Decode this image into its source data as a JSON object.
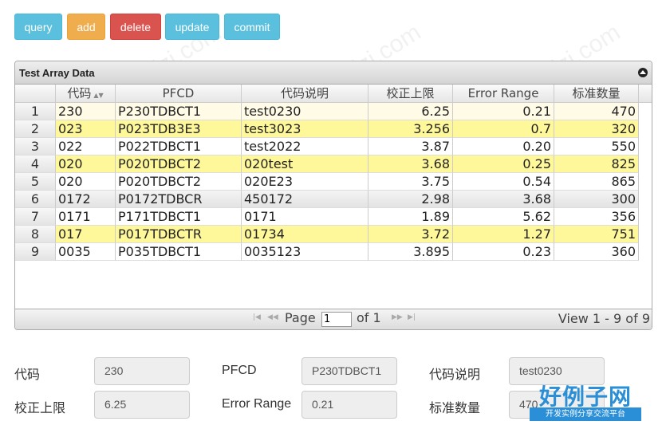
{
  "toolbar": {
    "query": "query",
    "add": "add",
    "delete": "delete",
    "update": "update",
    "commit": "commit"
  },
  "grid": {
    "caption": "Test Array Data",
    "columns": [
      "代码",
      "PFCD",
      "代码说明",
      "校正上限",
      "Error Range",
      "标准数量"
    ],
    "rows": [
      {
        "n": "1",
        "code": "230",
        "pfcd": "P230TDBCT1",
        "desc": "test0230",
        "upper": "6.25",
        "err": "0.21",
        "qty": "470"
      },
      {
        "n": "2",
        "code": "023",
        "pfcd": "P023TDB3E3",
        "desc": "test3023",
        "upper": "3.256",
        "err": "0.7",
        "qty": "320"
      },
      {
        "n": "3",
        "code": "022",
        "pfcd": "P022TDBCT1",
        "desc": "test2022",
        "upper": "3.87",
        "err": "0.20",
        "qty": "550"
      },
      {
        "n": "4",
        "code": "020",
        "pfcd": "P020TDBCT2",
        "desc": "020test",
        "upper": "3.68",
        "err": "0.25",
        "qty": "825"
      },
      {
        "n": "5",
        "code": "020",
        "pfcd": "P020TDBCT2",
        "desc": "020E23",
        "upper": "3.75",
        "err": "0.54",
        "qty": "865"
      },
      {
        "n": "6",
        "code": "0172",
        "pfcd": "P0172TDBCR",
        "desc": "450172",
        "upper": "2.98",
        "err": "3.68",
        "qty": "300"
      },
      {
        "n": "7",
        "code": "0171",
        "pfcd": "P171TDBCT1",
        "desc": "0171",
        "upper": "1.89",
        "err": "5.62",
        "qty": "356"
      },
      {
        "n": "8",
        "code": "017",
        "pfcd": "P017TDBCTR",
        "desc": "01734",
        "upper": "3.72",
        "err": "1.27",
        "qty": "751"
      },
      {
        "n": "9",
        "code": "0035",
        "pfcd": "P035TDBCT1",
        "desc": "0035123",
        "upper": "3.895",
        "err": "0.23",
        "qty": "360"
      }
    ],
    "pager": {
      "page_label": "Page",
      "page_value": "1",
      "of_label": "of 1",
      "view_text": "View 1 - 9 of 9"
    }
  },
  "form": {
    "code_label": "代码",
    "code_value": "230",
    "pfcd_label": "PFCD",
    "pfcd_value": "P230TDBCT1",
    "desc_label": "代码说明",
    "desc_value": "test0230",
    "upper_label": "校正上限",
    "upper_value": "6.25",
    "err_label": "Error Range",
    "err_value": "0.21",
    "qty_label": "标准数量",
    "qty_value": "470"
  },
  "watermark": {
    "text": "www.haolizi.com",
    "logo_big": "好例子网",
    "logo_small": "开发实例分享交流平台"
  },
  "colors": {
    "info": "#5bc0de",
    "warning": "#f0ad4e",
    "danger": "#d9534f",
    "highlight_row": "#fff89b",
    "logo_blue": "#2a8fd6"
  }
}
